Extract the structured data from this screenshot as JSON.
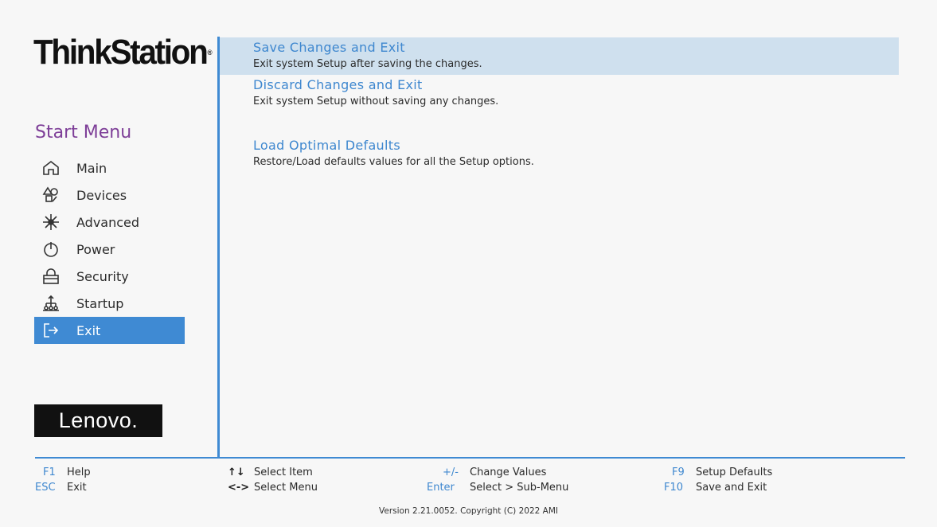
{
  "brand": {
    "think": "ThinkStation",
    "tm": "®"
  },
  "sidebar": {
    "title": "Start Menu",
    "items": [
      {
        "label": "Main",
        "icon": "home-icon"
      },
      {
        "label": "Devices",
        "icon": "devices-icon"
      },
      {
        "label": "Advanced",
        "icon": "advanced-icon"
      },
      {
        "label": "Power",
        "icon": "power-icon"
      },
      {
        "label": "Security",
        "icon": "security-icon"
      },
      {
        "label": "Startup",
        "icon": "startup-icon"
      },
      {
        "label": "Exit",
        "icon": "exit-icon",
        "active": true
      }
    ],
    "logo": "Lenovo."
  },
  "options": [
    {
      "title": "Save Changes and Exit",
      "desc": "Exit system Setup after saving the changes.",
      "selected": true
    },
    {
      "title": "Discard Changes and Exit",
      "desc": "Exit system Setup without saving any changes."
    },
    {
      "title": "Load Optimal Defaults",
      "desc": "Restore/Load defaults values for all the Setup options."
    }
  ],
  "help": {
    "f1_key": "F1",
    "f1_label": "Help",
    "esc_key": "ESC",
    "esc_label": "Exit",
    "updown_key": "↑↓",
    "updown_label": "Select Item",
    "leftright_key": "<->",
    "leftright_label": "Select Menu",
    "pm_key": "+/-",
    "pm_label": "Change Values",
    "enter_key": "Enter",
    "enter_label": "Select > Sub-Menu",
    "f9_key": "F9",
    "f9_label": "Setup Defaults",
    "f10_key": "F10",
    "f10_label": "Save and Exit"
  },
  "version": "Version 2.21.0052. Copyright (C) 2022 AMI",
  "colors": {
    "accent": "#3f8ad3",
    "selected_bg": "#cfe0ee",
    "menu_title": "#7e3f98",
    "brand_dot": "#d81e05"
  }
}
